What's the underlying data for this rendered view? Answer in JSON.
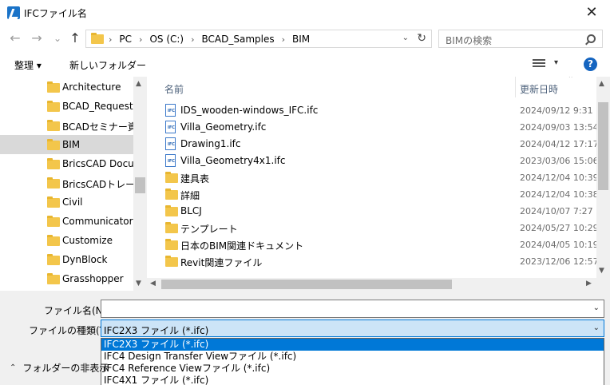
{
  "window": {
    "title": "IFCファイル名",
    "close_glyph": "✕"
  },
  "nav": {
    "back_glyph": "←",
    "forward_glyph": "→",
    "recent_glyph": "⌄",
    "up_glyph": "↑",
    "breadcrumb": [
      "PC",
      "OS (C:)",
      "BCAD_Samples",
      "BIM"
    ],
    "separator": "›",
    "dropdown_glyph": "⌄",
    "refresh_glyph": "↻",
    "search_placeholder": "BIMの検索"
  },
  "toolbar": {
    "organize": "整理 ▾",
    "new_folder": "新しいフォルダー",
    "view_drop": "▾",
    "help": "?"
  },
  "sidebar": {
    "items": [
      {
        "label": "Architecture",
        "selected": false
      },
      {
        "label": "BCAD_Requests",
        "selected": false
      },
      {
        "label": "BCADセミナー資料",
        "selected": false
      },
      {
        "label": "BIM",
        "selected": true
      },
      {
        "label": "BricsCAD Docum",
        "selected": false
      },
      {
        "label": "BricsCADトレーニン",
        "selected": false
      },
      {
        "label": "Civil",
        "selected": false
      },
      {
        "label": "Communicator",
        "selected": false
      },
      {
        "label": "Customize",
        "selected": false
      },
      {
        "label": "DynBlock",
        "selected": false
      },
      {
        "label": "Grasshopper",
        "selected": false
      }
    ],
    "scroll_up": "▲",
    "scroll_down": "▼"
  },
  "filelist": {
    "col_name": "名前",
    "col_date": "更新日時",
    "sort_glyph": "⌃",
    "rows": [
      {
        "name": "IDS_wooden-windows_IFC.ifc",
        "date": "2024/09/12 9:31",
        "type": "ifc"
      },
      {
        "name": "Villa_Geometry.ifc",
        "date": "2024/09/03 13:54",
        "type": "ifc"
      },
      {
        "name": "Drawing1.ifc",
        "date": "2024/04/12 17:17",
        "type": "ifc"
      },
      {
        "name": "Villa_Geometry4x1.ifc",
        "date": "2023/03/06 15:06",
        "type": "ifc"
      },
      {
        "name": "建具表",
        "date": "2024/12/04 10:39",
        "type": "folder"
      },
      {
        "name": "詳細",
        "date": "2024/12/04 10:38",
        "type": "folder"
      },
      {
        "name": "BLCJ",
        "date": "2024/10/07 7:27",
        "type": "folder"
      },
      {
        "name": "テンプレート",
        "date": "2024/05/27 10:29",
        "type": "folder"
      },
      {
        "name": "日本のBIM関連ドキュメント",
        "date": "2024/04/05 10:19",
        "type": "folder"
      },
      {
        "name": "Revit関連ファイル",
        "date": "2023/12/06 12:57",
        "type": "folder"
      }
    ],
    "scroll_up": "▲",
    "scroll_down": "▼",
    "scroll_left": "◀",
    "scroll_right": "▶"
  },
  "bottom": {
    "filename_label": "ファイル名(N):",
    "filename_value": "",
    "filetype_label": "ファイルの種類(T):",
    "filetype_selected": "IFC2X3 ファイル (*.ifc)",
    "drop_glyph": "⌄",
    "options": [
      "IFC2X3 ファイル (*.ifc)",
      "IFC4 Design Transfer Viewファイル (*.ifc)",
      "IFC4 Reference Viewファイル (*.ifc)",
      "IFC4X1 ファイル (*.ifc)"
    ],
    "hide_folders": "フォルダーの非表示",
    "hide_glyph": "⌃"
  }
}
